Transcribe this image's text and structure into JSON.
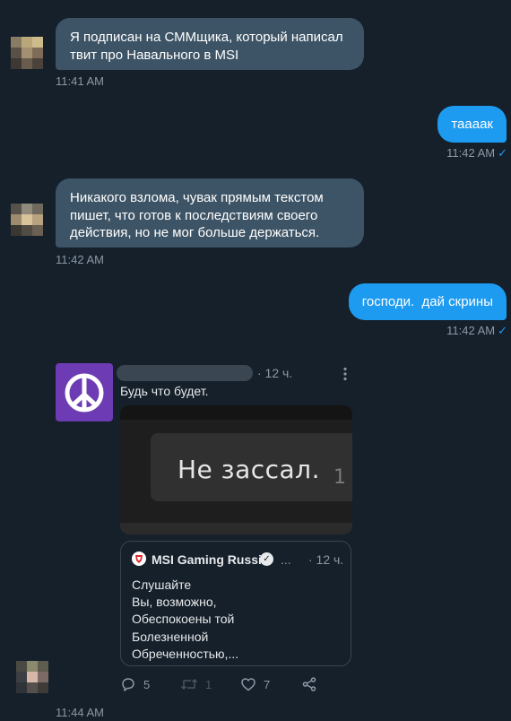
{
  "messages": {
    "m1": {
      "text_line1": "Я подписан на СММщика, который написал",
      "text_line2": "твит про Навального в MSI",
      "time": "11:41 AM"
    },
    "m2": {
      "text": "тааaак",
      "time": "11:42 AM"
    },
    "m3": {
      "text_line1": "Никакого взлома, чувак прямым текстом",
      "text_line2": "пишет, что готов к последствиям своего",
      "text_line3": "действия, но не мог больше держаться.",
      "time": "11:42 AM"
    },
    "m4": {
      "text": "господи.  дай скрины",
      "time": "11:42 AM"
    },
    "m5": {
      "time": "11:44 AM"
    }
  },
  "tweet": {
    "time": "· 12 ч.",
    "more": "⋮",
    "text": "Будь что будет.",
    "media": {
      "caption": "Не зассал.",
      "partial_number": "1"
    },
    "avatar_icon": "peace-sign-icon",
    "quote": {
      "name": "MSI Gaming Russia",
      "dots": "...",
      "time": "· 12 ч.",
      "lines": [
        "Слушайте",
        "Вы, возможно,",
        "Обеспокоены той",
        "Болезненной",
        "Обреченностью,..."
      ]
    },
    "actions": {
      "replies": "5",
      "retweets": "1",
      "likes": "7"
    }
  },
  "colors": {
    "background": "#15202b",
    "incoming_bubble": "#3d5466",
    "outgoing_bubble": "#1d9bf0",
    "timestamp": "#8b98a5",
    "avatar_purple": "#6d3bb3"
  }
}
